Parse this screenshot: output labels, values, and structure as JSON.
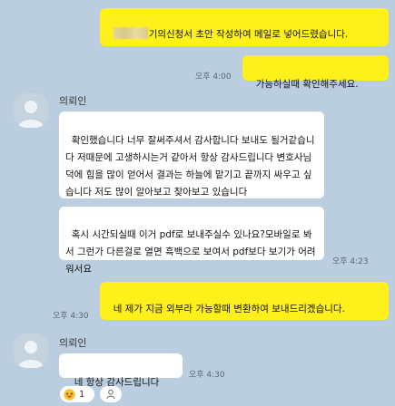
{
  "messages": {
    "m1": {
      "text": "기의신청서 초안 작성하여 메일로 넣어드렸습니다."
    },
    "m2": {
      "text": "가능하실때 확인해주세요.",
      "time": "오후 4:00"
    },
    "sender": {
      "name": "의뢰인"
    },
    "m3": {
      "text": "확인했습니다 너무 잘써주셔서 감사합니다 보내도 될거같습니다 저때문에 고생하시는거 같아서 항상 감사드립니다 변호사님 덕에 힘을 많이 얻어서 결과는 하늘에 맡기고 끝까지 싸우고 싶습니다 저도 많이 알아보고 찾아보고 있습니다"
    },
    "m4": {
      "text": "혹시 시간되실때 이거 pdf로 보내주실수 있나요?모바일로 봐서 그런가 다른걸로 열면 흑백으로 보여서 pdf보다 보기가 어려워서요",
      "time": "오후 4:23"
    },
    "m5": {
      "text": "네 제가 지금 외부라 가능할때 변환하여 보내드리겠습니다.",
      "time": "오후 4:30"
    },
    "m6": {
      "text": "네 항상 감사드립니다",
      "time": "오후 4:30"
    },
    "reaction": {
      "count": "1"
    }
  }
}
